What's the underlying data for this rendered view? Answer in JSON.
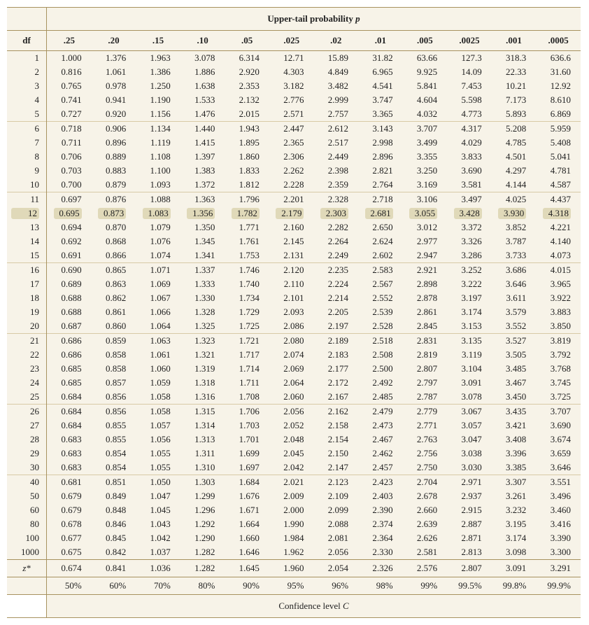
{
  "chart_data": {
    "type": "table",
    "title": "Upper-tail probability p",
    "footer": "Confidence level C",
    "upper_tail_p": [
      ".25",
      ".20",
      ".15",
      ".10",
      ".05",
      ".025",
      ".02",
      ".01",
      ".005",
      ".0025",
      ".001",
      ".0005"
    ],
    "confidence_levels": [
      "50%",
      "60%",
      "70%",
      "80%",
      "90%",
      "95%",
      "96%",
      "98%",
      "99%",
      "99.5%",
      "99.8%",
      "99.9%"
    ],
    "df_label": "df",
    "zstar_label": "z*",
    "highlighted_df": 12,
    "rows": [
      {
        "df": "1",
        "v": [
          "1.000",
          "1.376",
          "1.963",
          "3.078",
          "6.314",
          "12.71",
          "15.89",
          "31.82",
          "63.66",
          "127.3",
          "318.3",
          "636.6"
        ]
      },
      {
        "df": "2",
        "v": [
          "0.816",
          "1.061",
          "1.386",
          "1.886",
          "2.920",
          "4.303",
          "4.849",
          "6.965",
          "9.925",
          "14.09",
          "22.33",
          "31.60"
        ]
      },
      {
        "df": "3",
        "v": [
          "0.765",
          "0.978",
          "1.250",
          "1.638",
          "2.353",
          "3.182",
          "3.482",
          "4.541",
          "5.841",
          "7.453",
          "10.21",
          "12.92"
        ]
      },
      {
        "df": "4",
        "v": [
          "0.741",
          "0.941",
          "1.190",
          "1.533",
          "2.132",
          "2.776",
          "2.999",
          "3.747",
          "4.604",
          "5.598",
          "7.173",
          "8.610"
        ]
      },
      {
        "df": "5",
        "v": [
          "0.727",
          "0.920",
          "1.156",
          "1.476",
          "2.015",
          "2.571",
          "2.757",
          "3.365",
          "4.032",
          "4.773",
          "5.893",
          "6.869"
        ]
      },
      {
        "df": "6",
        "v": [
          "0.718",
          "0.906",
          "1.134",
          "1.440",
          "1.943",
          "2.447",
          "2.612",
          "3.143",
          "3.707",
          "4.317",
          "5.208",
          "5.959"
        ],
        "sep": true
      },
      {
        "df": "7",
        "v": [
          "0.711",
          "0.896",
          "1.119",
          "1.415",
          "1.895",
          "2.365",
          "2.517",
          "2.998",
          "3.499",
          "4.029",
          "4.785",
          "5.408"
        ]
      },
      {
        "df": "8",
        "v": [
          "0.706",
          "0.889",
          "1.108",
          "1.397",
          "1.860",
          "2.306",
          "2.449",
          "2.896",
          "3.355",
          "3.833",
          "4.501",
          "5.041"
        ]
      },
      {
        "df": "9",
        "v": [
          "0.703",
          "0.883",
          "1.100",
          "1.383",
          "1.833",
          "2.262",
          "2.398",
          "2.821",
          "3.250",
          "3.690",
          "4.297",
          "4.781"
        ]
      },
      {
        "df": "10",
        "v": [
          "0.700",
          "0.879",
          "1.093",
          "1.372",
          "1.812",
          "2.228",
          "2.359",
          "2.764",
          "3.169",
          "3.581",
          "4.144",
          "4.587"
        ]
      },
      {
        "df": "11",
        "v": [
          "0.697",
          "0.876",
          "1.088",
          "1.363",
          "1.796",
          "2.201",
          "2.328",
          "2.718",
          "3.106",
          "3.497",
          "4.025",
          "4.437"
        ],
        "sep": true
      },
      {
        "df": "12",
        "v": [
          "0.695",
          "0.873",
          "1.083",
          "1.356",
          "1.782",
          "2.179",
          "2.303",
          "2.681",
          "3.055",
          "3.428",
          "3.930",
          "4.318"
        ],
        "hl": true
      },
      {
        "df": "13",
        "v": [
          "0.694",
          "0.870",
          "1.079",
          "1.350",
          "1.771",
          "2.160",
          "2.282",
          "2.650",
          "3.012",
          "3.372",
          "3.852",
          "4.221"
        ]
      },
      {
        "df": "14",
        "v": [
          "0.692",
          "0.868",
          "1.076",
          "1.345",
          "1.761",
          "2.145",
          "2.264",
          "2.624",
          "2.977",
          "3.326",
          "3.787",
          "4.140"
        ]
      },
      {
        "df": "15",
        "v": [
          "0.691",
          "0.866",
          "1.074",
          "1.341",
          "1.753",
          "2.131",
          "2.249",
          "2.602",
          "2.947",
          "3.286",
          "3.733",
          "4.073"
        ]
      },
      {
        "df": "16",
        "v": [
          "0.690",
          "0.865",
          "1.071",
          "1.337",
          "1.746",
          "2.120",
          "2.235",
          "2.583",
          "2.921",
          "3.252",
          "3.686",
          "4.015"
        ],
        "sep": true
      },
      {
        "df": "17",
        "v": [
          "0.689",
          "0.863",
          "1.069",
          "1.333",
          "1.740",
          "2.110",
          "2.224",
          "2.567",
          "2.898",
          "3.222",
          "3.646",
          "3.965"
        ]
      },
      {
        "df": "18",
        "v": [
          "0.688",
          "0.862",
          "1.067",
          "1.330",
          "1.734",
          "2.101",
          "2.214",
          "2.552",
          "2.878",
          "3.197",
          "3.611",
          "3.922"
        ]
      },
      {
        "df": "19",
        "v": [
          "0.688",
          "0.861",
          "1.066",
          "1.328",
          "1.729",
          "2.093",
          "2.205",
          "2.539",
          "2.861",
          "3.174",
          "3.579",
          "3.883"
        ]
      },
      {
        "df": "20",
        "v": [
          "0.687",
          "0.860",
          "1.064",
          "1.325",
          "1.725",
          "2.086",
          "2.197",
          "2.528",
          "2.845",
          "3.153",
          "3.552",
          "3.850"
        ]
      },
      {
        "df": "21",
        "v": [
          "0.686",
          "0.859",
          "1.063",
          "1.323",
          "1.721",
          "2.080",
          "2.189",
          "2.518",
          "2.831",
          "3.135",
          "3.527",
          "3.819"
        ],
        "sep": true
      },
      {
        "df": "22",
        "v": [
          "0.686",
          "0.858",
          "1.061",
          "1.321",
          "1.717",
          "2.074",
          "2.183",
          "2.508",
          "2.819",
          "3.119",
          "3.505",
          "3.792"
        ]
      },
      {
        "df": "23",
        "v": [
          "0.685",
          "0.858",
          "1.060",
          "1.319",
          "1.714",
          "2.069",
          "2.177",
          "2.500",
          "2.807",
          "3.104",
          "3.485",
          "3.768"
        ]
      },
      {
        "df": "24",
        "v": [
          "0.685",
          "0.857",
          "1.059",
          "1.318",
          "1.711",
          "2.064",
          "2.172",
          "2.492",
          "2.797",
          "3.091",
          "3.467",
          "3.745"
        ]
      },
      {
        "df": "25",
        "v": [
          "0.684",
          "0.856",
          "1.058",
          "1.316",
          "1.708",
          "2.060",
          "2.167",
          "2.485",
          "2.787",
          "3.078",
          "3.450",
          "3.725"
        ]
      },
      {
        "df": "26",
        "v": [
          "0.684",
          "0.856",
          "1.058",
          "1.315",
          "1.706",
          "2.056",
          "2.162",
          "2.479",
          "2.779",
          "3.067",
          "3.435",
          "3.707"
        ],
        "sep": true
      },
      {
        "df": "27",
        "v": [
          "0.684",
          "0.855",
          "1.057",
          "1.314",
          "1.703",
          "2.052",
          "2.158",
          "2.473",
          "2.771",
          "3.057",
          "3.421",
          "3.690"
        ]
      },
      {
        "df": "28",
        "v": [
          "0.683",
          "0.855",
          "1.056",
          "1.313",
          "1.701",
          "2.048",
          "2.154",
          "2.467",
          "2.763",
          "3.047",
          "3.408",
          "3.674"
        ]
      },
      {
        "df": "29",
        "v": [
          "0.683",
          "0.854",
          "1.055",
          "1.311",
          "1.699",
          "2.045",
          "2.150",
          "2.462",
          "2.756",
          "3.038",
          "3.396",
          "3.659"
        ]
      },
      {
        "df": "30",
        "v": [
          "0.683",
          "0.854",
          "1.055",
          "1.310",
          "1.697",
          "2.042",
          "2.147",
          "2.457",
          "2.750",
          "3.030",
          "3.385",
          "3.646"
        ]
      },
      {
        "df": "40",
        "v": [
          "0.681",
          "0.851",
          "1.050",
          "1.303",
          "1.684",
          "2.021",
          "2.123",
          "2.423",
          "2.704",
          "2.971",
          "3.307",
          "3.551"
        ],
        "sep": true
      },
      {
        "df": "50",
        "v": [
          "0.679",
          "0.849",
          "1.047",
          "1.299",
          "1.676",
          "2.009",
          "2.109",
          "2.403",
          "2.678",
          "2.937",
          "3.261",
          "3.496"
        ]
      },
      {
        "df": "60",
        "v": [
          "0.679",
          "0.848",
          "1.045",
          "1.296",
          "1.671",
          "2.000",
          "2.099",
          "2.390",
          "2.660",
          "2.915",
          "3.232",
          "3.460"
        ]
      },
      {
        "df": "80",
        "v": [
          "0.678",
          "0.846",
          "1.043",
          "1.292",
          "1.664",
          "1.990",
          "2.088",
          "2.374",
          "2.639",
          "2.887",
          "3.195",
          "3.416"
        ]
      },
      {
        "df": "100",
        "v": [
          "0.677",
          "0.845",
          "1.042",
          "1.290",
          "1.660",
          "1.984",
          "2.081",
          "2.364",
          "2.626",
          "2.871",
          "3.174",
          "3.390"
        ]
      },
      {
        "df": "1000",
        "v": [
          "0.675",
          "0.842",
          "1.037",
          "1.282",
          "1.646",
          "1.962",
          "2.056",
          "2.330",
          "2.581",
          "2.813",
          "3.098",
          "3.300"
        ]
      }
    ],
    "zstar": [
      "0.674",
      "0.841",
      "1.036",
      "1.282",
      "1.645",
      "1.960",
      "2.054",
      "2.326",
      "2.576",
      "2.807",
      "3.091",
      "3.291"
    ]
  }
}
